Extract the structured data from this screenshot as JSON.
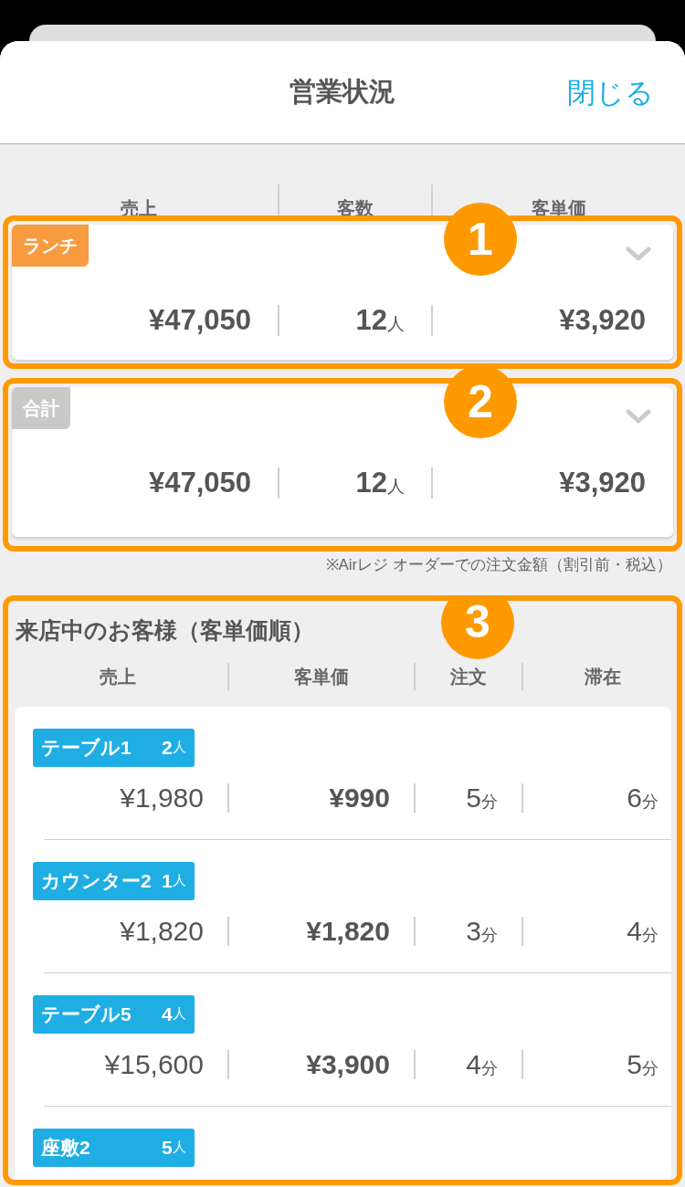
{
  "header": {
    "title": "営業状況",
    "close": "閉じる"
  },
  "summary_columns": [
    "売上",
    "客数",
    "客単価"
  ],
  "summary_cards": [
    {
      "tag": "ランチ",
      "kind": "lunch",
      "callout": "1",
      "sales": "¥47,050",
      "customers": "12",
      "customers_unit": "人",
      "unit_price": "¥3,920"
    },
    {
      "tag": "合計",
      "kind": "total",
      "callout": "2",
      "sales": "¥47,050",
      "customers": "12",
      "customers_unit": "人",
      "unit_price": "¥3,920"
    }
  ],
  "note": "※Airレジ オーダーでの注文金額（割引前・税込）",
  "guests_section": {
    "callout": "3",
    "title": "来店中のお客様（客単価順）",
    "columns": [
      "売上",
      "客単価",
      "注文",
      "滞在"
    ],
    "rows": [
      {
        "name": "テーブル1",
        "guests": "2",
        "guests_unit": "人",
        "sales": "¥1,980",
        "unit_price": "¥990",
        "order": "5",
        "order_unit": "分",
        "stay": "6",
        "stay_unit": "分"
      },
      {
        "name": "カウンター2",
        "guests": "1",
        "guests_unit": "人",
        "sales": "¥1,820",
        "unit_price": "¥1,820",
        "order": "3",
        "order_unit": "分",
        "stay": "4",
        "stay_unit": "分"
      },
      {
        "name": "テーブル5",
        "guests": "4",
        "guests_unit": "人",
        "sales": "¥15,600",
        "unit_price": "¥3,900",
        "order": "4",
        "order_unit": "分",
        "stay": "5",
        "stay_unit": "分"
      },
      {
        "name": "座敷2",
        "guests": "5",
        "guests_unit": "人"
      }
    ]
  }
}
